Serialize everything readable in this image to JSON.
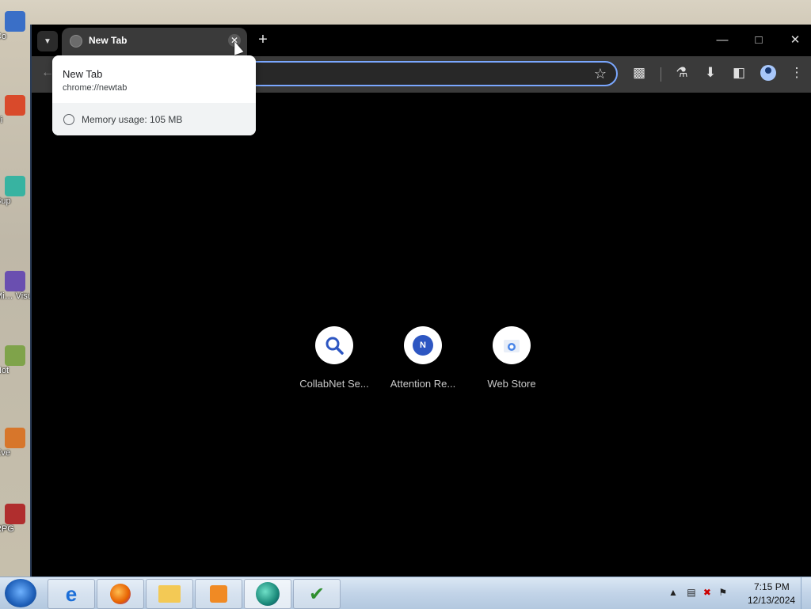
{
  "desktop": {
    "icons": [
      {
        "label": "Co"
      },
      {
        "label": "Fi"
      },
      {
        "label": "Sup"
      },
      {
        "label": "Mi… Visu"
      },
      {
        "label": "Not"
      },
      {
        "label": "Eve"
      },
      {
        "label": "RPG"
      }
    ]
  },
  "browser": {
    "tab": {
      "title": "New Tab",
      "close_label": "✕"
    },
    "new_tab_label": "+",
    "window_controls": {
      "minimize": "—",
      "maximize": "□",
      "close": "✕"
    },
    "hover_card": {
      "title": "New Tab",
      "url": "chrome://newtab",
      "memory": "Memory usage: 105 MB"
    },
    "toolbar_icons": [
      "extensions-icon",
      "labs-flask-icon",
      "download-icon",
      "side-panel-icon",
      "profile-icon",
      "menu-icon"
    ],
    "shortcuts": [
      {
        "label": "CollabNet Se...",
        "icon": "search-icon"
      },
      {
        "label": "Attention Re...",
        "icon": "n-letter-icon",
        "badge": "N"
      },
      {
        "label": "Web Store",
        "icon": "webstore-icon"
      }
    ]
  },
  "taskbar": {
    "apps": [
      "internet-explorer-icon",
      "firefox-icon",
      "file-explorer-icon",
      "media-player-icon",
      "browser-app-icon",
      "task-app-icon"
    ],
    "clock": {
      "time": "7:15 PM",
      "date": "12/13/2024"
    }
  },
  "colors": {
    "accent": "#7aa7ff",
    "window_bg": "#000000",
    "toolbar_bg": "#3a3a3a"
  }
}
